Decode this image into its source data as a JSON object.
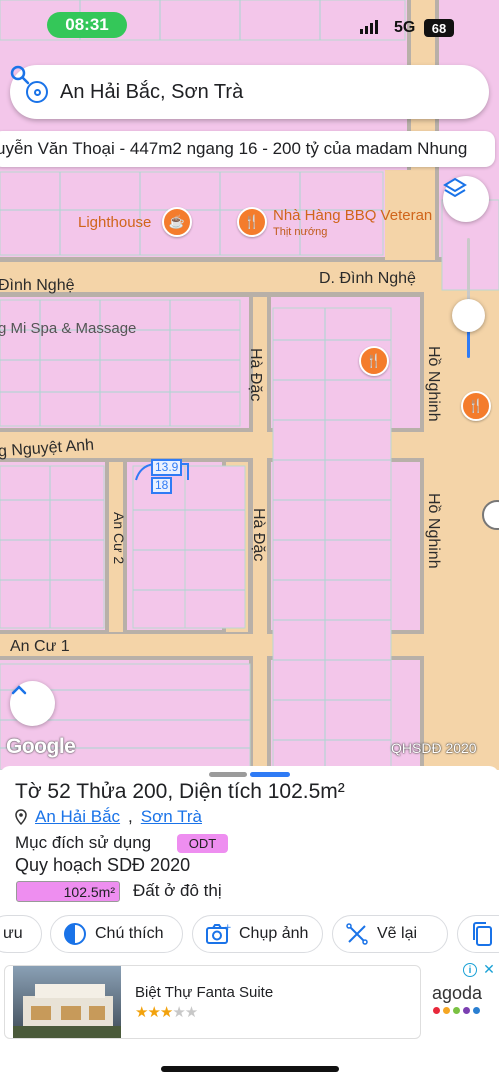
{
  "status": {
    "time": "08:31",
    "network": "5G",
    "battery": "68"
  },
  "search": {
    "query": "An Hải Bắc, Sơn Trà"
  },
  "banner": {
    "text": "uyễn Văn Thoại - 447m2 ngang 16 - 200 tỷ của madam Nhung"
  },
  "map": {
    "streets": [
      {
        "name": "Đình Nghệ"
      },
      {
        "name": "D. Đình Nghệ"
      },
      {
        "name": "Hà Đặc"
      },
      {
        "name": "Hồ Nghinh"
      },
      {
        "name": "Hồ Nghinh"
      },
      {
        "name": "g Nguyệt Anh"
      },
      {
        "name": "An Cư 2"
      },
      {
        "name": "Hà Đặc"
      },
      {
        "name": "An Cư 1"
      }
    ],
    "pois": [
      {
        "name": "Lighthouse",
        "icon": "cafe-icon"
      },
      {
        "name": "Nhà Hàng BBQ Veteran",
        "sub": "Thịt nướng",
        "icon": "restaurant-icon"
      },
      {
        "name": "g Mi Spa & Massage"
      }
    ],
    "dimensions": {
      "top": "13.9",
      "bottom": "18"
    },
    "attribution": "Google",
    "layer_label": "QHSDĐ 2020"
  },
  "sheet": {
    "title": "Tờ 52 Thửa 200, Diện tích 102.5m²",
    "district": "An Hải Bắc",
    "city": "Sơn Trà",
    "purpose_label": "Mục đích sử dụng",
    "purpose_code": "ODT",
    "plan_label": "Quy hoạch SDĐ 2020",
    "area_value": "102.5m²",
    "area_desc": "Đất ở đô thị",
    "actions": [
      {
        "label": "ưu",
        "icon": "save-icon"
      },
      {
        "label": "Chú thích",
        "icon": "legend-icon"
      },
      {
        "label": "Chụp ảnh",
        "icon": "camera-icon"
      },
      {
        "label": "Vẽ lại",
        "icon": "redraw-icon"
      },
      {
        "label": "",
        "icon": "copy-icon"
      }
    ],
    "ad": {
      "title": "Biệt Thự Fanta Suite",
      "rating": 3,
      "rating_max": 5,
      "brand": "agoda"
    }
  },
  "colors": {
    "accent": "#2f7bf5",
    "parcel": "#f3c6ea",
    "road": "#f4d4a8",
    "badge": "#ee8ef0"
  }
}
